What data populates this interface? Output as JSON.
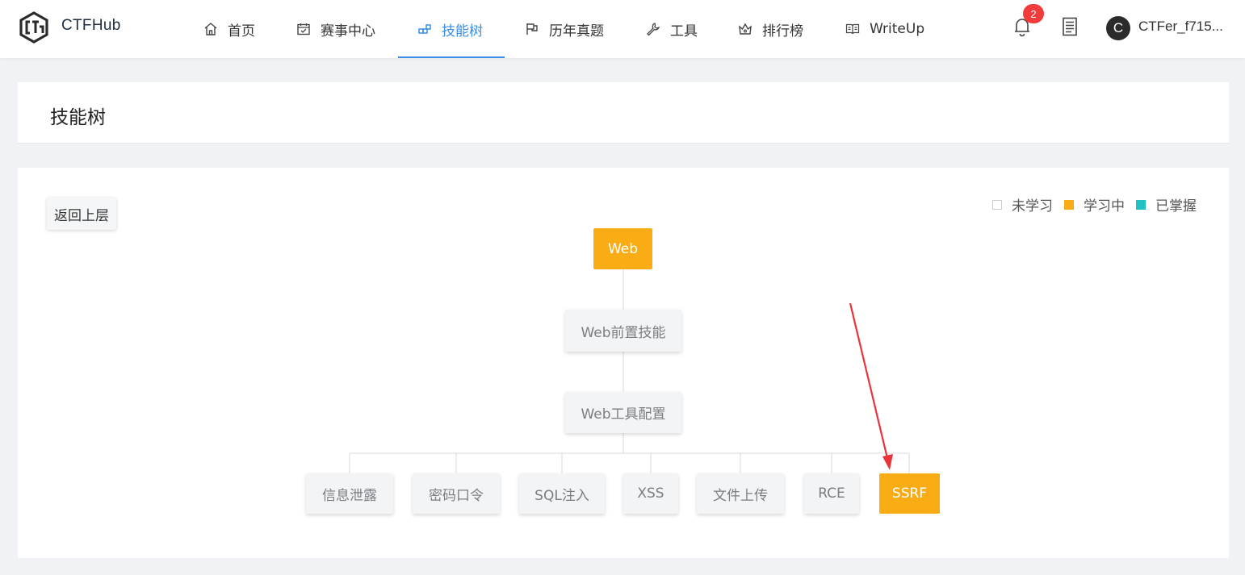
{
  "navbar": {
    "brand": "CTFHub",
    "items": [
      {
        "label": "首页",
        "icon": "home-icon"
      },
      {
        "label": "赛事中心",
        "icon": "calendar-icon"
      },
      {
        "label": "技能树",
        "icon": "skill-tree-icon"
      },
      {
        "label": "历年真题",
        "icon": "flag-icon"
      },
      {
        "label": "工具",
        "icon": "wrench-icon"
      },
      {
        "label": "排行榜",
        "icon": "crown-icon"
      },
      {
        "label": "WriteUp",
        "icon": "book-icon"
      }
    ],
    "active_index": 2,
    "notification_count": "2",
    "avatar_letter": "C",
    "username": "CTFer_f715..."
  },
  "page": {
    "title": "技能树",
    "back_button": "返回上层"
  },
  "legend": [
    {
      "label": "未学习",
      "color": "#ffffff",
      "border": "#c9ccd1"
    },
    {
      "label": "学习中",
      "color": "#f9ac14",
      "border": "#f9ac14"
    },
    {
      "label": "已掌握",
      "color": "#1fc1c3",
      "border": "#1fc1c3"
    }
  ],
  "tree": {
    "root": {
      "label": "Web",
      "status": "learning"
    },
    "level1": {
      "label": "Web前置技能",
      "status": "not-learned"
    },
    "level2": {
      "label": "Web工具配置",
      "status": "not-learned"
    },
    "leaves": [
      {
        "label": "信息泄露",
        "status": "not-learned"
      },
      {
        "label": "密码口令",
        "status": "not-learned"
      },
      {
        "label": "SQL注入",
        "status": "not-learned"
      },
      {
        "label": "XSS",
        "status": "not-learned"
      },
      {
        "label": "文件上传",
        "status": "not-learned"
      },
      {
        "label": "RCE",
        "status": "not-learned"
      },
      {
        "label": "SSRF",
        "status": "learning"
      }
    ]
  },
  "colors": {
    "accent": "#3a8ee6",
    "learning": "#f9ac14",
    "mastered": "#1fc1c3",
    "annotation_arrow": "#e8343a"
  }
}
